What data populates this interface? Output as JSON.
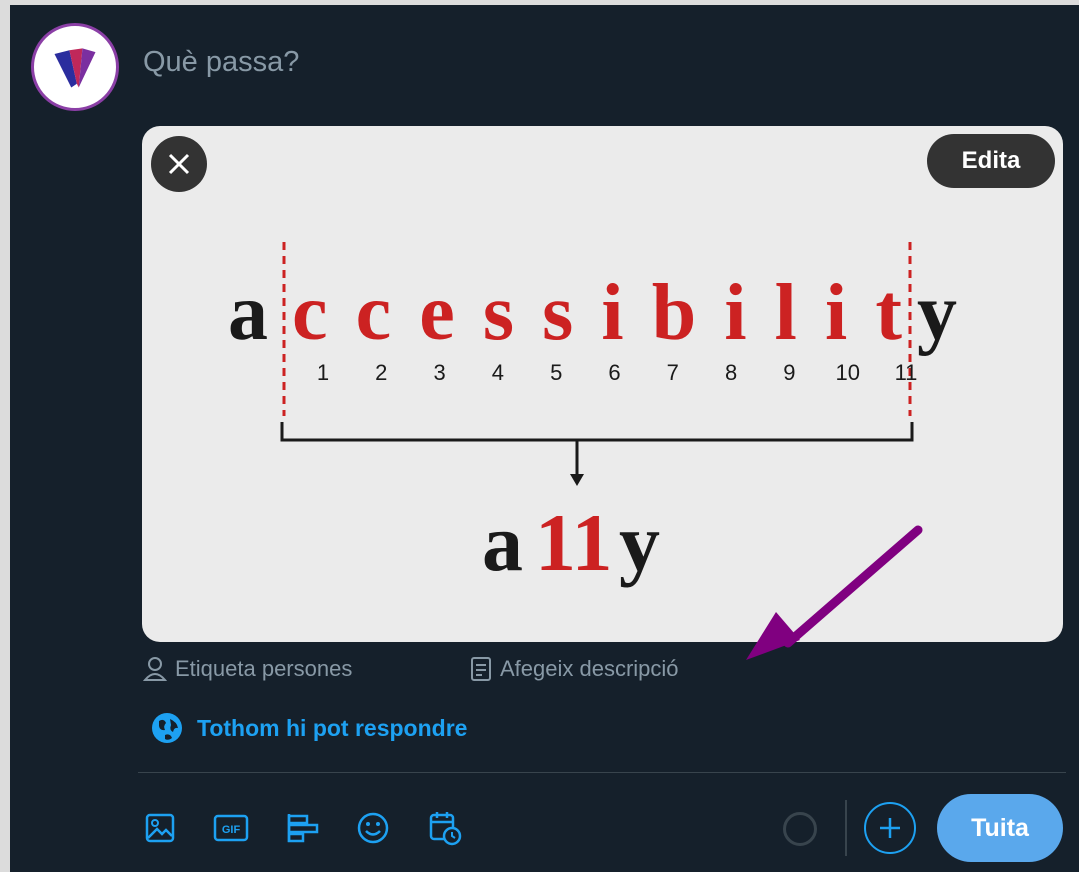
{
  "composer": {
    "placeholder": "Què passa?",
    "avatar_icon": "brand-logo-v"
  },
  "media": {
    "edit_label": "Edita",
    "close_icon": "close-icon",
    "image": {
      "word_first": "a",
      "word_middle": "ccessibilit",
      "word_last": "y",
      "numbers": [
        "1",
        "2",
        "3",
        "4",
        "5",
        "6",
        "7",
        "8",
        "9",
        "10",
        "11"
      ],
      "abbr_first": "a",
      "abbr_middle": "11",
      "abbr_last": "y",
      "accent": "#cc2222"
    }
  },
  "actions": {
    "tag_people": "Etiqueta persones",
    "add_description": "Afegeix descripció"
  },
  "reply_setting": "Tothom hi pot respondre",
  "toolbar": {
    "icons": [
      "image-icon",
      "gif-icon",
      "poll-icon",
      "emoji-icon",
      "schedule-icon"
    ],
    "tweet_label": "Tuita"
  },
  "colors": {
    "background": "#15202b",
    "accent_blue": "#1da1f2",
    "tweet_button": "#5aa8ec",
    "arrow": "#800080"
  }
}
